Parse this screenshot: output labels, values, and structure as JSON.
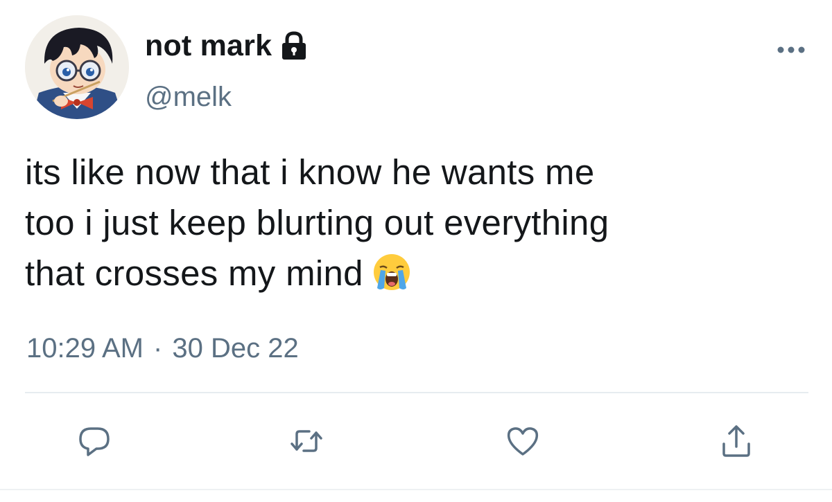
{
  "tweet": {
    "author": {
      "display_name": "not mark",
      "handle": "@melk",
      "avatar": "anime-character-avatar",
      "protected_icon": "lock-icon"
    },
    "more_icon": "more-dots-icon",
    "text_lines": [
      "its like now that i know he wants me",
      "too i just keep blurting out everything",
      "that crosses my mind"
    ],
    "emoji": "loudly-crying-face-emoji",
    "time": "10:29 AM",
    "separator": "·",
    "date": "30 Dec 22"
  },
  "actions": [
    {
      "name": "reply",
      "icon": "reply-icon"
    },
    {
      "name": "retweet",
      "icon": "retweet-icon"
    },
    {
      "name": "like",
      "icon": "heart-icon"
    },
    {
      "name": "share",
      "icon": "share-icon"
    }
  ],
  "colors": {
    "text": "#14171a",
    "secondary": "#5b7083",
    "icon": "#5b7083",
    "divider": "#e6ecf0"
  }
}
